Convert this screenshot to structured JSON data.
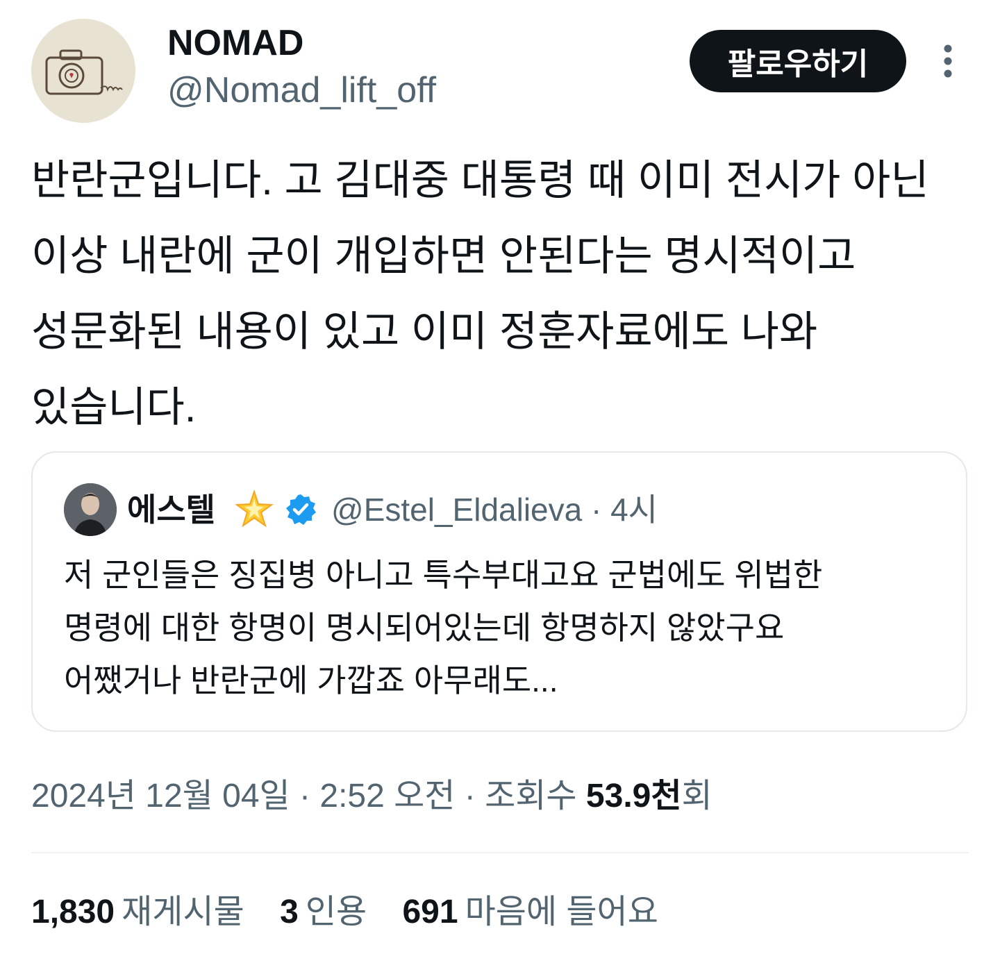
{
  "author": {
    "display_name": "NOMAD",
    "handle": "@Nomad_lift_off"
  },
  "follow_button_label": "팔로우하기",
  "tweet_lines": [
    "반란군입니다. 고 김대중 대통령 때 이미 전시가 아닌",
    "이상 내란에 군이 개입하면 안된다는 명시적이고",
    "성문화된 내용이 있고 이미 정훈자료에도 나와",
    "있습니다."
  ],
  "quoted": {
    "display_name": "에스텔",
    "handle_time": "@Estel_Eldalieva · 4시",
    "text_lines": [
      "저 군인들은 징집병 아니고 특수부대고요 군법에도 위법한",
      "명령에 대한 항명이 명시되어있는데 항명하지 않았구요",
      "어쨌거나 반란군에 가깝죠 아무래도..."
    ]
  },
  "meta": {
    "datetime": "2024년 12월 04일 · 2:52 오전 · 조회수 ",
    "views_number": "53.9천",
    "views_suffix": "회"
  },
  "stats": [
    {
      "number": "1,830",
      "label": "재게시물"
    },
    {
      "number": "3",
      "label": "인용"
    },
    {
      "number": "691",
      "label": "마음에 들어요"
    }
  ],
  "icons": {
    "avatar_logo": "camera-icon",
    "more": "more-options-icon",
    "verified": "verified-badge-icon",
    "star": "sparkle-star-icon"
  },
  "colors": {
    "primary_text": "#0f1419",
    "secondary_text": "#536471",
    "follow_bg": "#0f1419",
    "verified_blue": "#1d9bf0",
    "border": "#e5e7eb"
  }
}
